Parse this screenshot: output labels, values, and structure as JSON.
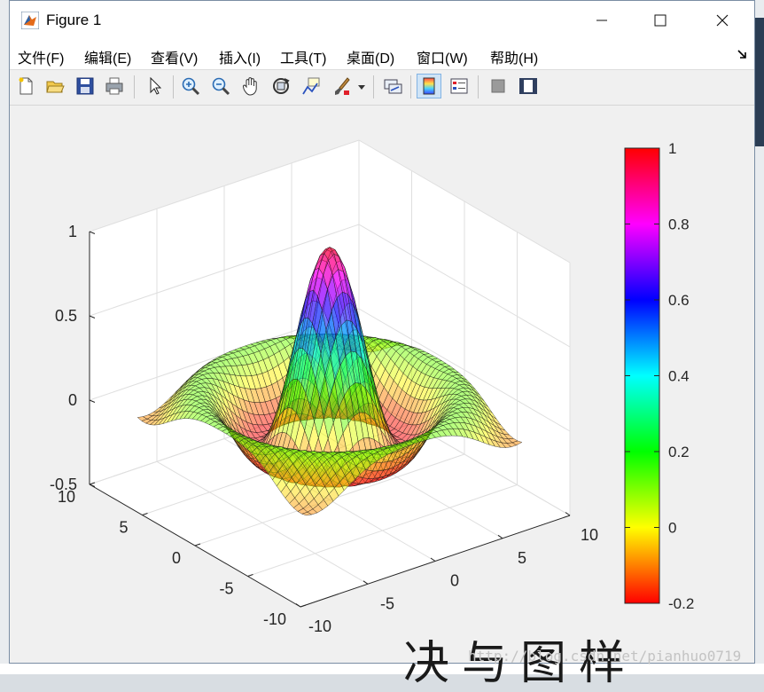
{
  "window": {
    "title": "Figure 1",
    "minimize": "—",
    "maximize": "☐",
    "close": "✕"
  },
  "menu": [
    {
      "label": "文件(F)"
    },
    {
      "label": "编辑(E)"
    },
    {
      "label": "查看(V)"
    },
    {
      "label": "插入(I)"
    },
    {
      "label": "工具(T)"
    },
    {
      "label": "桌面(D)"
    },
    {
      "label": "窗口(W)"
    },
    {
      "label": "帮助(H)"
    }
  ],
  "toolbar": [
    "new-file-icon",
    "open-folder-icon",
    "save-icon",
    "print-icon",
    "pointer-icon",
    "zoom-in-icon",
    "zoom-out-icon",
    "pan-hand-icon",
    "rotate-3d-icon",
    "data-cursor-icon",
    "brush-icon",
    "link-plot-icon",
    "colorbar-icon",
    "legend-icon",
    "hide-plot-tools-icon",
    "show-plot-tools-icon"
  ],
  "chart_data": {
    "type": "surface",
    "function": "sinc(r)",
    "xlim": [
      -10,
      10
    ],
    "ylim": [
      -10,
      10
    ],
    "zlim": [
      -0.5,
      1
    ],
    "x_ticks": [
      "-10",
      "-5",
      "0",
      "5",
      "10"
    ],
    "y_ticks": [
      "-10",
      "-5",
      "0",
      "5",
      "10"
    ],
    "z_ticks": [
      "-0.5",
      "0",
      "0.5",
      "1"
    ],
    "colormap": "hsv",
    "color_limits": [
      -0.2,
      1
    ],
    "colorbar_ticks": [
      "1",
      "0.8",
      "0.6",
      "0.4",
      "0.2",
      "0",
      "-0.2"
    ],
    "grid": true,
    "face_alpha": 0.5
  },
  "background": {
    "bottom_text": "决与图样",
    "watermark": "http://blog.csdn.net/pianhuo0719"
  }
}
